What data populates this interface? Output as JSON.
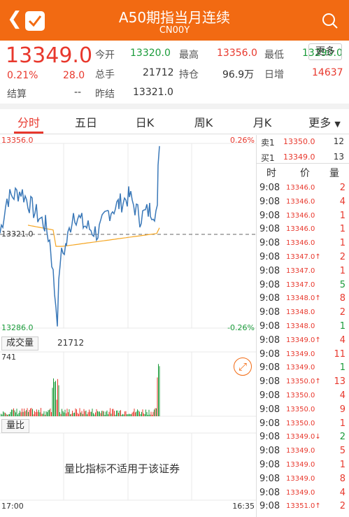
{
  "header": {
    "title": "A50期指当月连续",
    "code": "CN00Y"
  },
  "quote": {
    "price": "13349.0",
    "change_pct": "0.21%",
    "change": "28.0",
    "settle_label": "结算",
    "settle": "--",
    "open_label": "今开",
    "open": "13320.0",
    "high_label": "最高",
    "high": "13356.0",
    "low_label": "最低",
    "low": "13290.0",
    "volume_label": "总手",
    "volume": "21712",
    "oi_label": "持仓",
    "oi": "96.9万",
    "oi_chg_label": "日增",
    "oi_chg": "14637",
    "prev_label": "昨结",
    "prev": "13321.0",
    "more_label": "更多"
  },
  "tabs": [
    "分时",
    "五日",
    "日K",
    "周K",
    "月K",
    "更多"
  ],
  "chart": {
    "top_price": "13356.0",
    "top_pct": "0.26%",
    "mid_price": "13321.0",
    "bottom_price": "13286.0",
    "bottom_pct": "-0.26%",
    "volume_box": "成交量",
    "volume_val": "21712",
    "volume_max": "741",
    "ratio_box": "量比",
    "ratio_msg": "量比指标不适用于该证券",
    "time_start": "17:00",
    "time_end": "16:35",
    "colors": {
      "price_line": "#3a78b8",
      "avg_line": "#f5a623",
      "up": "#e8382d",
      "down": "#1a9b3a"
    }
  },
  "orderbook": {
    "sell": {
      "label": "卖1",
      "price": "13350.0",
      "qty": "12"
    },
    "buy": {
      "label": "买1",
      "price": "13349.0",
      "qty": "13"
    }
  },
  "trades_header": {
    "time": "时",
    "price": "价",
    "qty": "量"
  },
  "trades": [
    {
      "time": "9:08",
      "price": "13346.0",
      "qty": "2",
      "dir": "up"
    },
    {
      "time": "9:08",
      "price": "13346.0",
      "qty": "4",
      "dir": "up"
    },
    {
      "time": "9:08",
      "price": "13346.0",
      "qty": "1",
      "dir": "up"
    },
    {
      "time": "9:08",
      "price": "13346.0",
      "qty": "1",
      "dir": "up"
    },
    {
      "time": "9:08",
      "price": "13346.0",
      "qty": "1",
      "dir": "up"
    },
    {
      "time": "9:08",
      "price": "13347.0↑",
      "qty": "2",
      "dir": "up"
    },
    {
      "time": "9:08",
      "price": "13347.0",
      "qty": "1",
      "dir": "up"
    },
    {
      "time": "9:08",
      "price": "13347.0",
      "qty": "5",
      "dir": "down"
    },
    {
      "time": "9:08",
      "price": "13348.0↑",
      "qty": "8",
      "dir": "up"
    },
    {
      "time": "9:08",
      "price": "13348.0",
      "qty": "2",
      "dir": "up"
    },
    {
      "time": "9:08",
      "price": "13348.0",
      "qty": "1",
      "dir": "down"
    },
    {
      "time": "9:08",
      "price": "13349.0↑",
      "qty": "4",
      "dir": "up"
    },
    {
      "time": "9:08",
      "price": "13349.0",
      "qty": "11",
      "dir": "up"
    },
    {
      "time": "9:08",
      "price": "13349.0",
      "qty": "1",
      "dir": "down"
    },
    {
      "time": "9:08",
      "price": "13350.0↑",
      "qty": "13",
      "dir": "up"
    },
    {
      "time": "9:08",
      "price": "13350.0",
      "qty": "4",
      "dir": "up"
    },
    {
      "time": "9:08",
      "price": "13350.0",
      "qty": "9",
      "dir": "up"
    },
    {
      "time": "9:08",
      "price": "13350.0",
      "qty": "1",
      "dir": "up"
    },
    {
      "time": "9:08",
      "price": "13349.0↓",
      "qty": "2",
      "dir": "down"
    },
    {
      "time": "9:08",
      "price": "13349.0",
      "qty": "5",
      "dir": "up"
    },
    {
      "time": "9:08",
      "price": "13349.0",
      "qty": "1",
      "dir": "up"
    },
    {
      "time": "9:08",
      "price": "13349.0",
      "qty": "8",
      "dir": "up"
    },
    {
      "time": "9:08",
      "price": "13349.0",
      "qty": "4",
      "dir": "up"
    },
    {
      "time": "9:08",
      "price": "13351.0↑",
      "qty": "2",
      "dir": "up"
    }
  ]
}
